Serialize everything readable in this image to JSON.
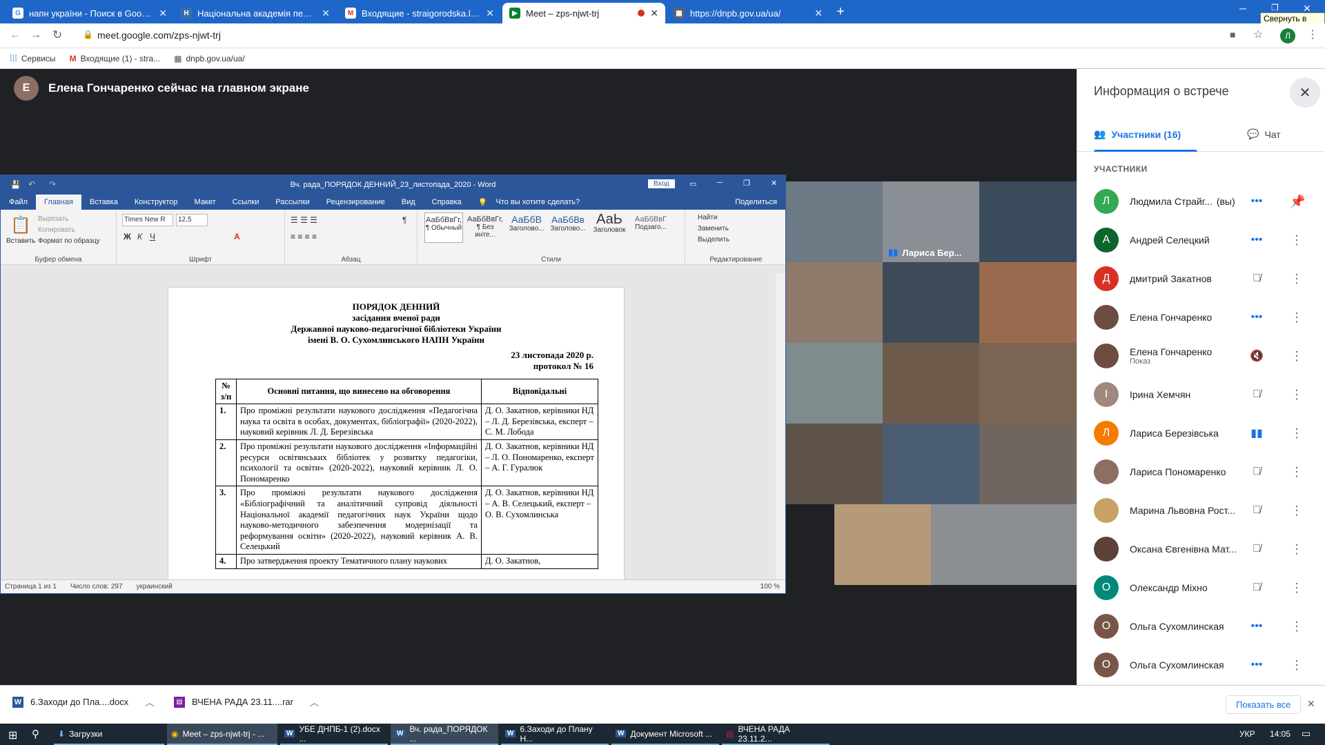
{
  "browser": {
    "tabs": [
      {
        "title": "напн україни - Поиск в Google",
        "icon": "google-g-icon"
      },
      {
        "title": "Національна академія педагогі",
        "icon": "naps-icon"
      },
      {
        "title": "Входящие - straigorodska.l@gm",
        "icon": "gmail-icon"
      },
      {
        "title": "Meet – zps-njwt-trj",
        "icon": "meet-icon",
        "active": true
      },
      {
        "title": "https://dnpb.gov.ua/ua/",
        "icon": "site-icon"
      }
    ],
    "tooltip": "Свернуть в окно",
    "url": "meet.google.com/zps-njwt-trj",
    "profile_initial": "Л",
    "bookmarks": [
      "Сервисы",
      "Входящие (1) - stra...",
      "dnpb.gov.ua/ua/"
    ]
  },
  "meet": {
    "presenter_banner": "Елена Гончаренко сейчас на главном экране",
    "video_label": "Лариса Бер...",
    "panel": {
      "title": "Информация о встрече",
      "tab_participants": "Участники (16)",
      "tab_chat": "Чат",
      "section_label": "УЧАСТНИКИ",
      "participants": [
        {
          "initial": "Л",
          "color": "#34a853",
          "name": "Людмила Страйг...",
          "suffix": "(вы)",
          "status": "dots",
          "action": "pin"
        },
        {
          "initial": "А",
          "color": "#0d652d",
          "name": "Андрей Селецкий",
          "status": "dots"
        },
        {
          "initial": "Д",
          "color": "#d93025",
          "name": "дмитрий Закатнов",
          "status": "muted"
        },
        {
          "initial": "",
          "color": "#6d4c41",
          "name": "Елена Гончаренко",
          "status": "dots"
        },
        {
          "initial": "",
          "color": "#6d4c41",
          "name": "Елена Гончаренко",
          "sub": "Показ",
          "status": "screen-muted"
        },
        {
          "initial": "І",
          "color": "#a1887f",
          "name": "Ірина Хемчян",
          "status": "muted"
        },
        {
          "initial": "Л",
          "color": "#f57c00",
          "name": "Лариса Березівська",
          "status": "speaking"
        },
        {
          "initial": "",
          "color": "#8d6e63",
          "name": "Лариса Пономаренко",
          "status": "muted"
        },
        {
          "initial": "",
          "color": "#c8a165",
          "name": "Марина Львовна Рост...",
          "status": "muted"
        },
        {
          "initial": "",
          "color": "#5d4037",
          "name": "Оксана Євгенівна Мат...",
          "status": "muted"
        },
        {
          "initial": "О",
          "color": "#00897b",
          "name": "Олександр Міхно",
          "status": "muted"
        },
        {
          "initial": "О",
          "color": "#795548",
          "name": "Ольга Сухомлинская",
          "status": "dots"
        },
        {
          "initial": "О",
          "color": "#795548",
          "name": "Ольга Сухомлинская",
          "status": "dots"
        }
      ]
    }
  },
  "word": {
    "window_title": "Вч. рада_ПОРЯДОК ДЕННИЙ_23_листопада_2020  -  Word",
    "signin": "Вход",
    "menu": [
      "Файл",
      "Главная",
      "Вставка",
      "Конструктор",
      "Макет",
      "Ссылки",
      "Рассылки",
      "Рецензирование",
      "Вид",
      "Справка"
    ],
    "tell_me": "Что вы хотите сделать?",
    "share": "Поделиться",
    "ribbon": {
      "paste": "Вставить",
      "cut": "Вырезать",
      "copy": "Копировать",
      "format_painter": "Формат по образцу",
      "clipboard": "Буфер обмена",
      "font_name": "Times New R",
      "font_size": "12,5",
      "font_group": "Шрифт",
      "paragraph_group": "Абзац",
      "styles_group": "Стили",
      "editing_group": "Редактирование",
      "find": "Найти",
      "replace": "Заменить",
      "select": "Выделить",
      "styles": [
        {
          "sample": "АаБбВвГг,",
          "name": "¶ Обычный"
        },
        {
          "sample": "АаБбВвГг,",
          "name": "¶ Без инте..."
        },
        {
          "sample": "АаБбВ",
          "name": "Заголово..."
        },
        {
          "sample": "АаБбВв",
          "name": "Заголово..."
        },
        {
          "sample": "АаЬ",
          "name": "Заголовок"
        },
        {
          "sample": "АаБбВвГ",
          "name": "Подзаго..."
        }
      ]
    },
    "status": {
      "page": "Страница 1 из 1",
      "words": "Число слов: 297",
      "lang": "украинский",
      "zoom": "100 %"
    },
    "doc": {
      "h1": "ПОРЯДОК ДЕННИЙ",
      "h2": "засідання вченої ради",
      "h3": "Державної науково-педагогічної бібліотеки України",
      "h4": "імені В. О. Сухомлинського НАПН України",
      "date": "23 листопада 2020 р.",
      "protocol": "протокол № 16",
      "col1": "№ з/п",
      "col2": "Основні питання, що винесено на обговорення",
      "col3": "Відповідальні",
      "rows": [
        {
          "n": "1.",
          "topic": "Про проміжні результати наукового дослідження «Педагогічна наука та освіта в особах, документах, бібліографії» (2020-2022), науковий керівник Л. Д. Березівська",
          "resp": "Д. О. Закатнов, керівники НД – Л. Д. Березівська, експерт – С. М. Лобода"
        },
        {
          "n": "2.",
          "topic": "Про проміжні результати наукового дослідження «Інформаційні ресурси освітянських бібліотек у розвитку педагогіки, психології та освіти» (2020-2022), науковий керівник Л. О. Пономаренко",
          "resp": "Д. О. Закатнов, керівники НД – Л. О. Пономаренко, експерт – А. Г. Гуралюк"
        },
        {
          "n": "3.",
          "topic": "Про проміжні результати наукового дослідження «Бібліографічний та аналітичний супровід діяльності Національної академії педагогічних наук України щодо науково-методичного забезпечення модернізації та реформування освіти» (2020-2022), науковий керівник А. В. Селецький",
          "resp": "Д. О. Закатнов, керівники НД – А. В. Селецький, експерт – О. В. Сухомлинська"
        },
        {
          "n": "4.",
          "topic": "Про затвердження проекту Тематичного плану наукових",
          "resp": "Д. О. Закатнов,"
        }
      ]
    }
  },
  "downloads": {
    "items": [
      "6.Заходи до Пла....docx",
      "ВЧЕНА РАДА 23.11....rar"
    ],
    "show_all": "Показать все"
  },
  "taskbar": {
    "items": [
      "Загрузки",
      "Meet – zps-njwt-trj - ...",
      "УБЕ ДНПБ-1 (2).docx ...",
      "Вч. рада_ПОРЯДОК ...",
      "6.Заходи до Плану Н...",
      "Документ Microsoft ...",
      "ВЧЕНА РАДА 23.11.2..."
    ],
    "lang": "УКР",
    "time": "14:05"
  }
}
